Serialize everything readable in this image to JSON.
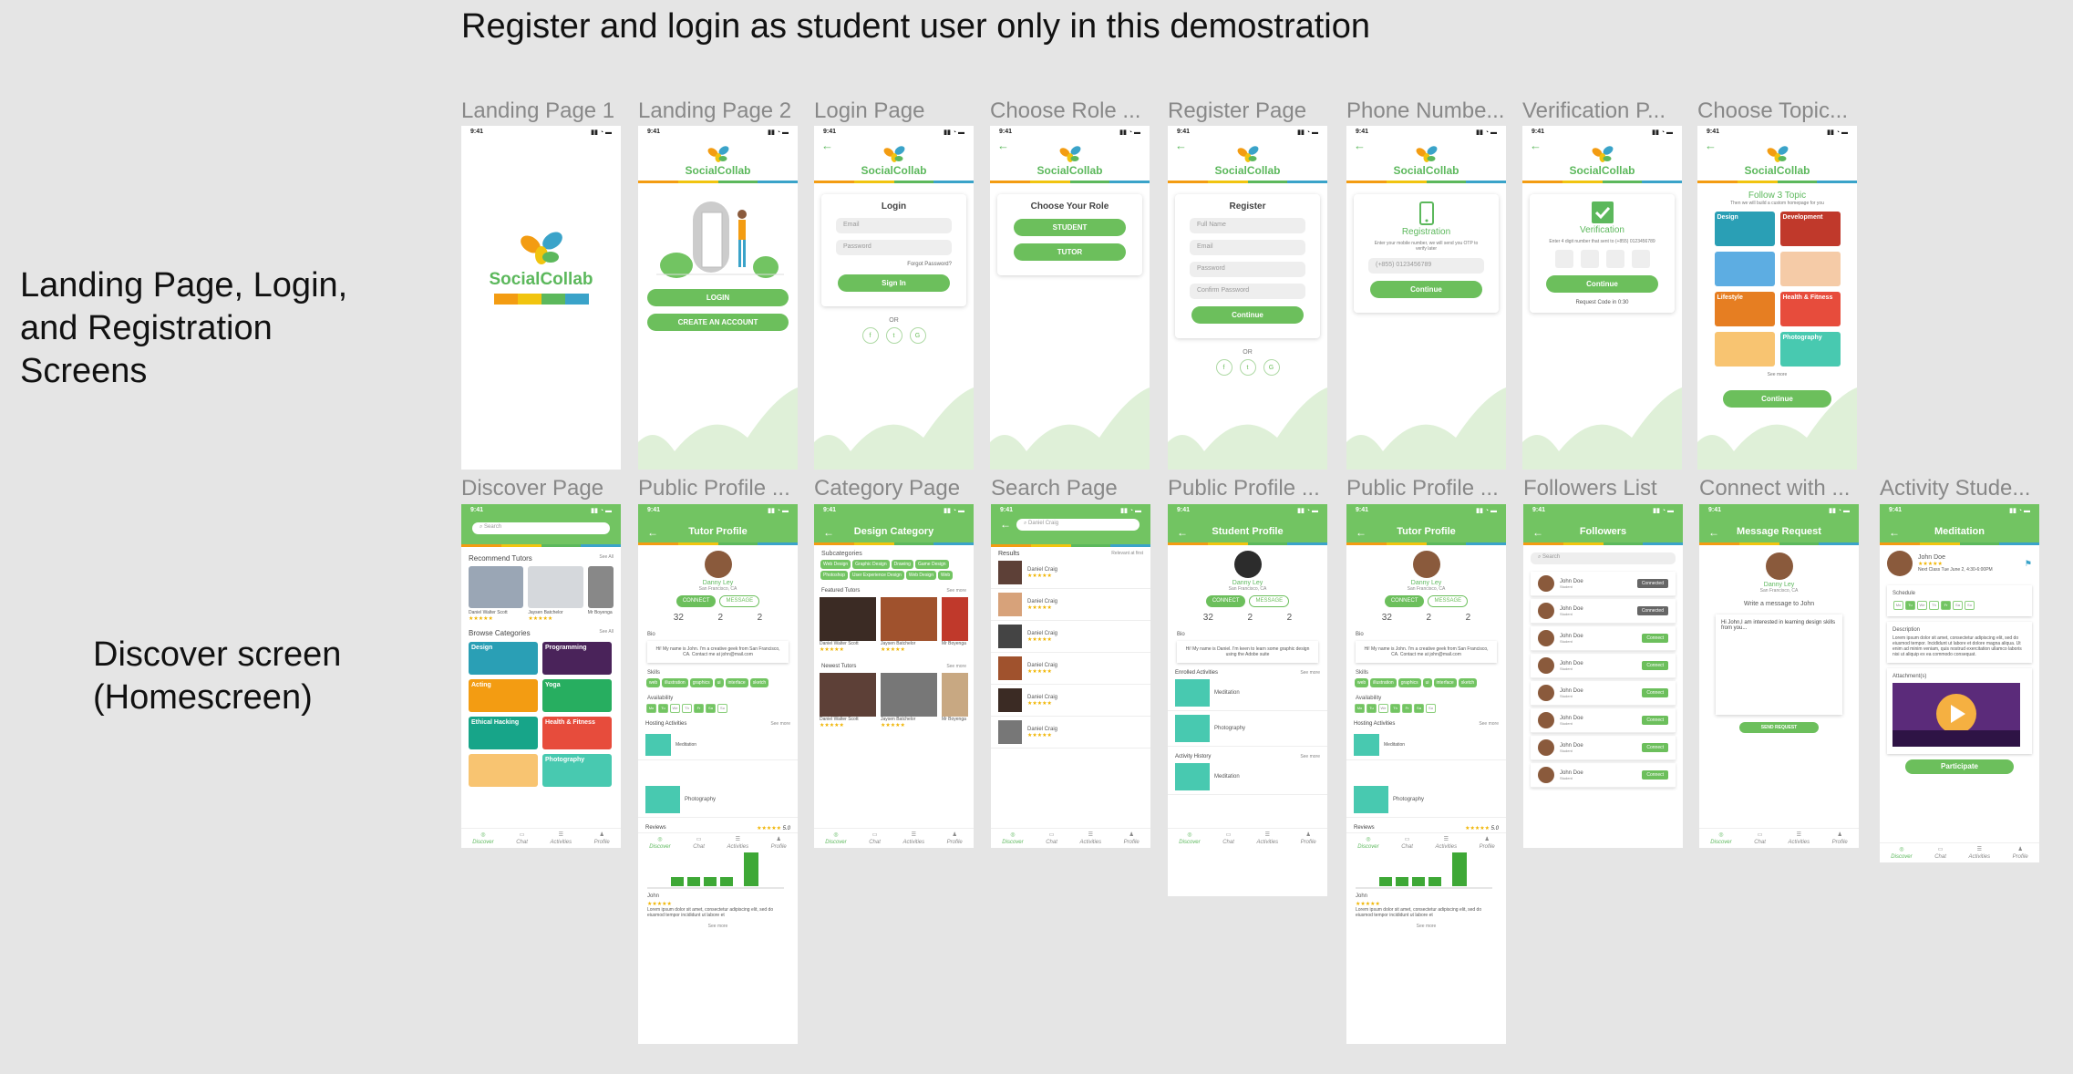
{
  "page_title": "Register and login as student user only in this demostration",
  "sections": [
    "Landing Page, Login, and Registration Screens",
    "Discover screen (Homescreen)"
  ],
  "row1_labels": [
    "Landing Page 1",
    "Landing Page 2",
    "Login Page",
    "Choose Role ...",
    "Register Page",
    "Phone Numbe...",
    "Verification P...",
    "Choose Topic..."
  ],
  "row2_labels": [
    "Discover Page",
    "Public Profile ...",
    "Category Page",
    "Search Page",
    "Public Profile ...",
    "Public Profile ...",
    "Followers List",
    "Connect with ...",
    "Activity Stude..."
  ],
  "status_time": "9:41",
  "brand": "SocialCollab",
  "colors": {
    "green": "#72c462",
    "stripe": [
      "#f39c12",
      "#f1c40f",
      "#5cb85c",
      "#3aa3c9"
    ]
  },
  "landing2": {
    "login": "LOGIN",
    "create": "CREATE AN ACCOUNT"
  },
  "login": {
    "title": "Login",
    "email": "Email",
    "password": "Password",
    "forgot": "Forgot Password?",
    "signin": "Sign In",
    "or": "OR"
  },
  "role": {
    "title": "Choose Your Role",
    "student": "STUDENT",
    "tutor": "TUTOR"
  },
  "register": {
    "title": "Register",
    "name": "Full Name",
    "email": "Email",
    "password": "Password",
    "confirm": "Confirm Password",
    "continue": "Continue",
    "or": "OR"
  },
  "phone": {
    "title": "Registration",
    "desc": "Enter your mobile number, we will send you OTP to verify later",
    "number": "(+855) 0123456789",
    "continue": "Continue"
  },
  "verify": {
    "title": "Verification",
    "desc": "Enter 4 digit number that sent to (+855) 0123456789",
    "continue": "Continue",
    "resend": "Request Code in 0:30"
  },
  "topic": {
    "title": "Follow 3 Topic",
    "sub": "Then we will build a custom homepage for you",
    "tiles": [
      "Design",
      "Development",
      "",
      "",
      "Lifestyle",
      "Health & Fitness",
      "",
      "Photography"
    ],
    "more": "See more",
    "continue": "Continue"
  },
  "discover": {
    "search": "Search",
    "tutors": "Recommend Tutors",
    "see_all": "See All",
    "tutor_names": [
      "Daniel Walter Scott",
      "Jaysen Batchelor",
      "Mr Boyenga"
    ],
    "categories": "Browse Categories",
    "cat_names": [
      "Design",
      "Programming",
      "Acting",
      "Yoga",
      "Ethical Hacking",
      "Health & Fitness",
      "",
      "Photography"
    ]
  },
  "tutor_profile": {
    "title": "Tutor Profile",
    "name": "Danny Ley",
    "loc": "San Francisco, CA",
    "connect": "CONNECT",
    "message": "MESSAGE",
    "followers": "32",
    "following": "2",
    "activities": "2",
    "bio": "Bio",
    "bio_text": "Hi! My name is John. I'm a creative geek from San Francisco, CA. Contact me at john@mail.com",
    "skills": "Skills",
    "skill_list": [
      "web",
      "illustration",
      "graphics",
      "ui",
      "interface",
      "sketch"
    ],
    "availability": "Availability",
    "hosting": "Hosting Activities",
    "see_more": "See more",
    "act1": "Meditation",
    "act2": "Photography",
    "reviews": "Reviews",
    "rating": "5.0",
    "reviewer": "John",
    "review_text": "Lorem ipsum dolor sit amet, consectetur adipiscing elit, sed do eiusmod tempor incididunt ut labore et"
  },
  "category": {
    "title": "Design Category",
    "sub": "Subcategories",
    "tags": [
      "Web Design",
      "Graphic Design",
      "Drawing",
      "Game Design",
      "Photoshop",
      "User Experience Design",
      "Web Design",
      "Web"
    ],
    "featured": "Featured Tutors",
    "newest": "Newest Tutors",
    "see_more": "See more",
    "names": [
      "Daniel Walter Scott",
      "Jaysen Batchelor",
      "Mr Boyenga"
    ]
  },
  "search": {
    "query": "Daniel Craig",
    "results": "Results",
    "relevant": "Relevant at first",
    "name": "Daniel Craig"
  },
  "student_profile": {
    "title": "Student Profile",
    "name": "Danny Ley",
    "bio_text": "Hi! My name is Daniel. I'm keen to learn some graphic design using the Adobe suite",
    "enrolled": "Enrolled Activities",
    "history": "Activity History"
  },
  "followers": {
    "title": "Followers",
    "search": "Search",
    "name": "John Doe",
    "role": "Student",
    "connected": "Connected",
    "connect": "Connect"
  },
  "message": {
    "title": "Message Request",
    "name": "Danny Ley",
    "prompt": "Write a message to John",
    "text": "Hi John,I am interested in learning design skills from you...",
    "send": "SEND REQUEST"
  },
  "activity": {
    "title": "Meditation",
    "host": "John Doe",
    "schedule": "Schedule",
    "desc": "Description",
    "desc_text": "Lorem ipsum dolor sit amet, consectetur adipiscing elit, sed do eiusmod tempor. Incididunt ut labore et dolore magna aliqua. Ut enim ad minim veniam, quis nostrud exercitation ullamco laboris nisi ut aliquip ex ea commodo consequat.",
    "attach": "Attachment(s)",
    "participate": "Participate",
    "next": "Next Class Tue June 2, 4:30-6:00PM"
  },
  "nav": [
    "Discover",
    "Chat",
    "Activities",
    "Profile"
  ]
}
